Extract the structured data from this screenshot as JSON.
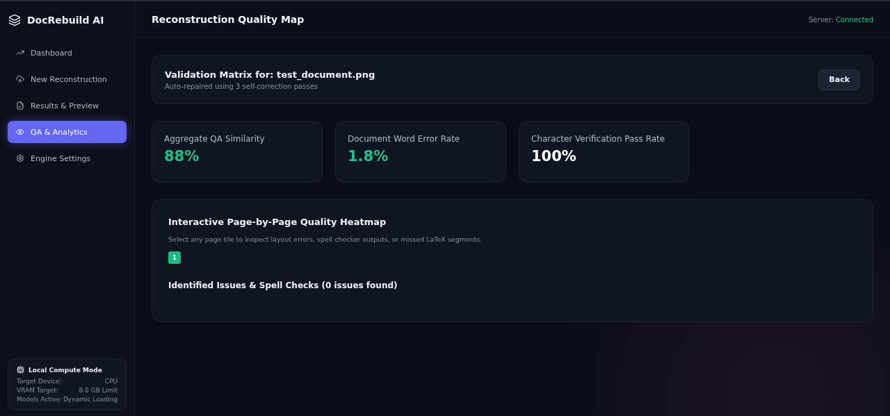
{
  "app": {
    "name": "DocRebuild AI"
  },
  "sidebar": {
    "items": [
      {
        "label": "Dashboard",
        "selected": false
      },
      {
        "label": "New Reconstruction",
        "selected": false
      },
      {
        "label": "Results & Preview",
        "selected": false
      },
      {
        "label": "QA & Analytics",
        "selected": true
      },
      {
        "label": "Engine Settings",
        "selected": false
      }
    ],
    "compute": {
      "title": "Local Compute Mode",
      "rows": [
        {
          "label": "Target Device:",
          "value": "CPU"
        },
        {
          "label": "VRAM Target:",
          "value": "8.0 GB Limit"
        },
        {
          "label": "Models Active:",
          "value": "Dynamic Loading"
        }
      ]
    }
  },
  "header": {
    "title": "Reconstruction Quality Map",
    "server_label": "Server:",
    "server_status": "Connected"
  },
  "validation": {
    "title": "Validation Matrix for: test_document.png",
    "subtitle": "Auto-repaired using 3 self-correction passes",
    "button": "Back"
  },
  "metrics": [
    {
      "label": "Aggregate QA Similarity",
      "value": "88%",
      "color": "#22c08a"
    },
    {
      "label": "Document Word Error Rate",
      "value": "1.8%",
      "color": "#22c08a"
    },
    {
      "label": "Character Verification Pass Rate",
      "value": "100%",
      "color": "#ffffff"
    }
  ],
  "heatmap": {
    "title": "Interactive Page-by-Page Quality Heatmap",
    "description": "Select any page tile to inspect layout errors, spell checker outputs, or missed LaTeX segments.",
    "tiles": [
      {
        "label": "1",
        "color": "#1fb882"
      }
    ],
    "issues_title": "Identified Issues & Spell Checks (0 issues found)"
  }
}
